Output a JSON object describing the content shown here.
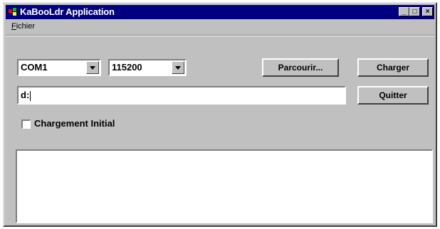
{
  "window": {
    "title": "KaBooLdr Application",
    "icon": "app-icon"
  },
  "menubar": {
    "items": [
      {
        "label": "Fichier",
        "accel": "F"
      }
    ]
  },
  "serial": {
    "port": "COM1",
    "baud": "115200"
  },
  "buttons": {
    "browse": "Parcourir...",
    "load": "Charger",
    "quit": "Quitter"
  },
  "path": {
    "value": "d:"
  },
  "options": {
    "initial_load_label": "Chargement Initial",
    "initial_load_checked": false
  },
  "log": {
    "text": ""
  },
  "colors": {
    "titlebar": "#000080",
    "face": "#c0c0c0"
  }
}
